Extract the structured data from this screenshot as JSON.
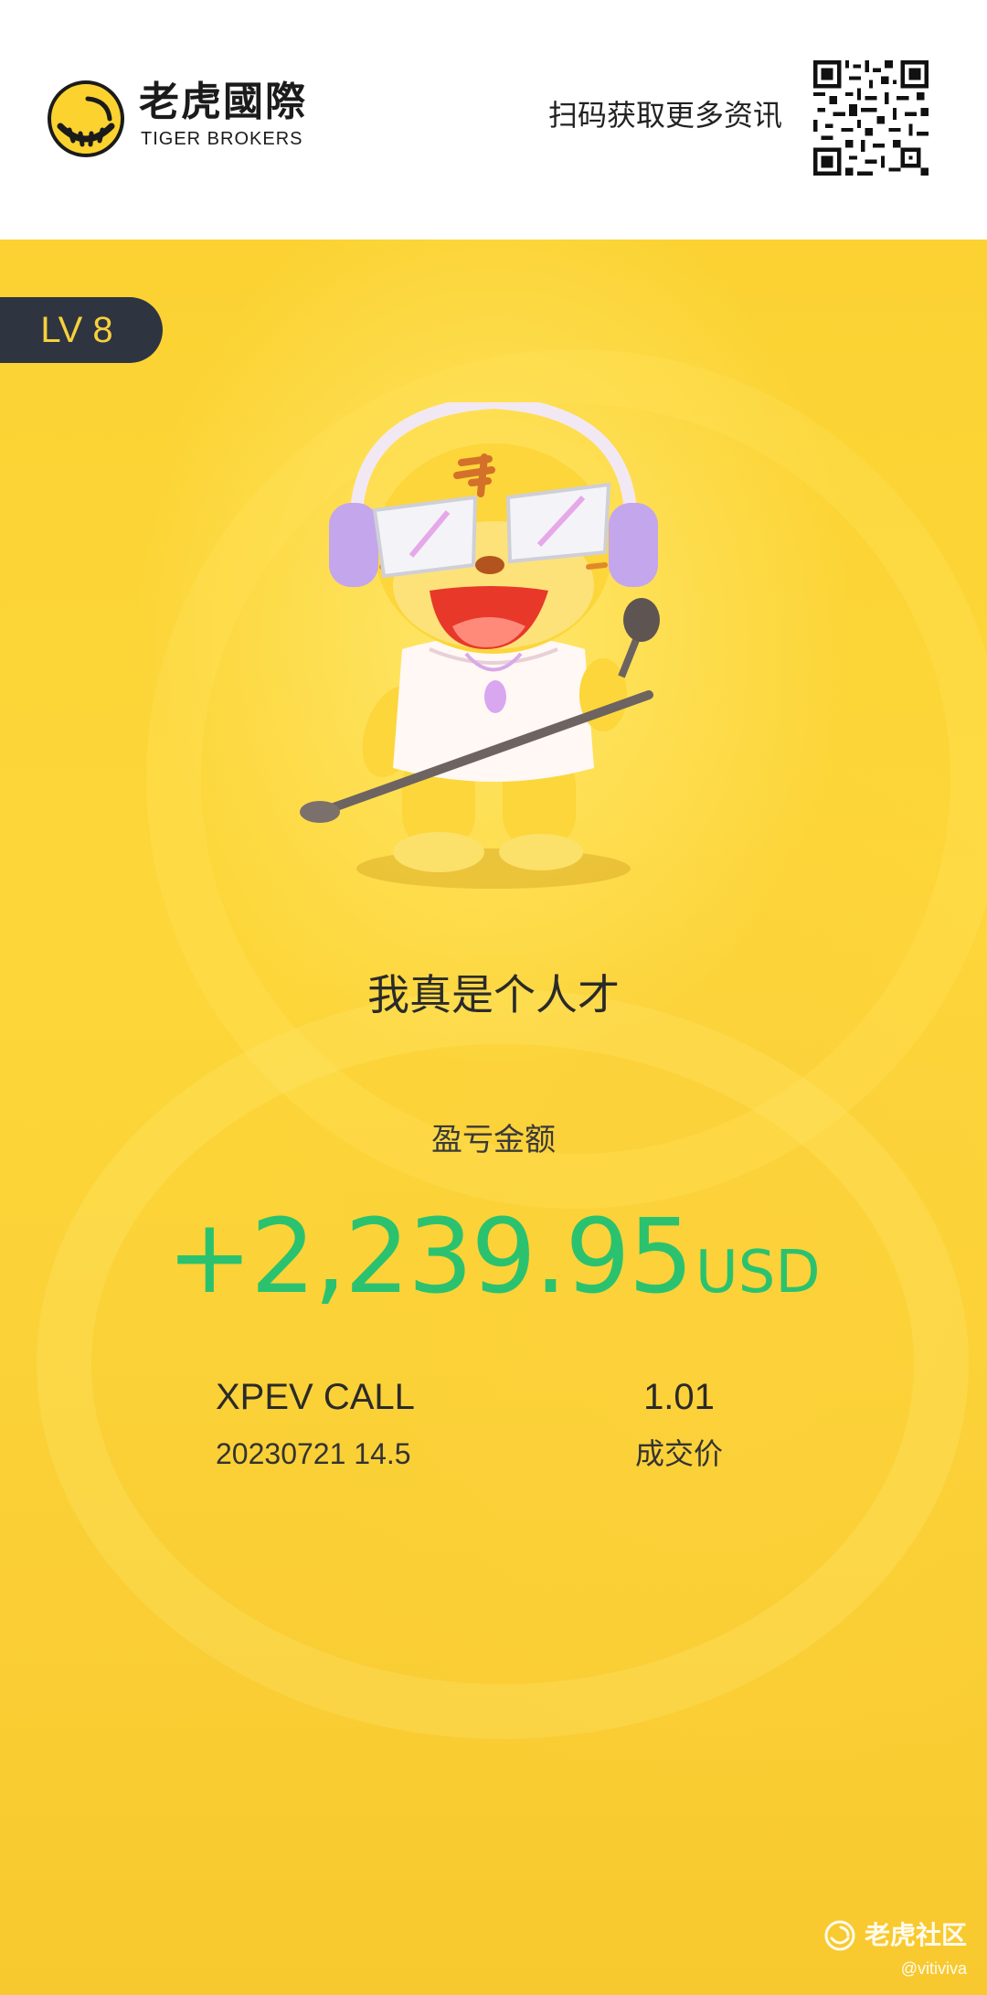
{
  "header": {
    "brand_cn": "老虎國際",
    "brand_en": "TIGER BROKERS",
    "scan_text": "扫码获取更多资讯",
    "logo_icon": "tiger-logo-icon",
    "qr_icon": "qr-code-icon"
  },
  "card": {
    "level": "LV 8",
    "slogan": "我真是个人才",
    "pnl_label": "盈亏金额",
    "pnl_amount": "+2,239.95",
    "pnl_currency": "USD",
    "ticker": "XPEV CALL",
    "contract": "20230721 14.5",
    "price": "1.01",
    "price_label": "成交价",
    "mascot_icon": "tiger-mascot-singing-illustration"
  },
  "watermark": {
    "text": "老虎社区",
    "user": "@vitiviva"
  },
  "colors": {
    "background_yellow": "#fbd232",
    "profit_green": "#2bc26f",
    "badge_dark": "#2f3441",
    "badge_text": "#f7d13b"
  }
}
